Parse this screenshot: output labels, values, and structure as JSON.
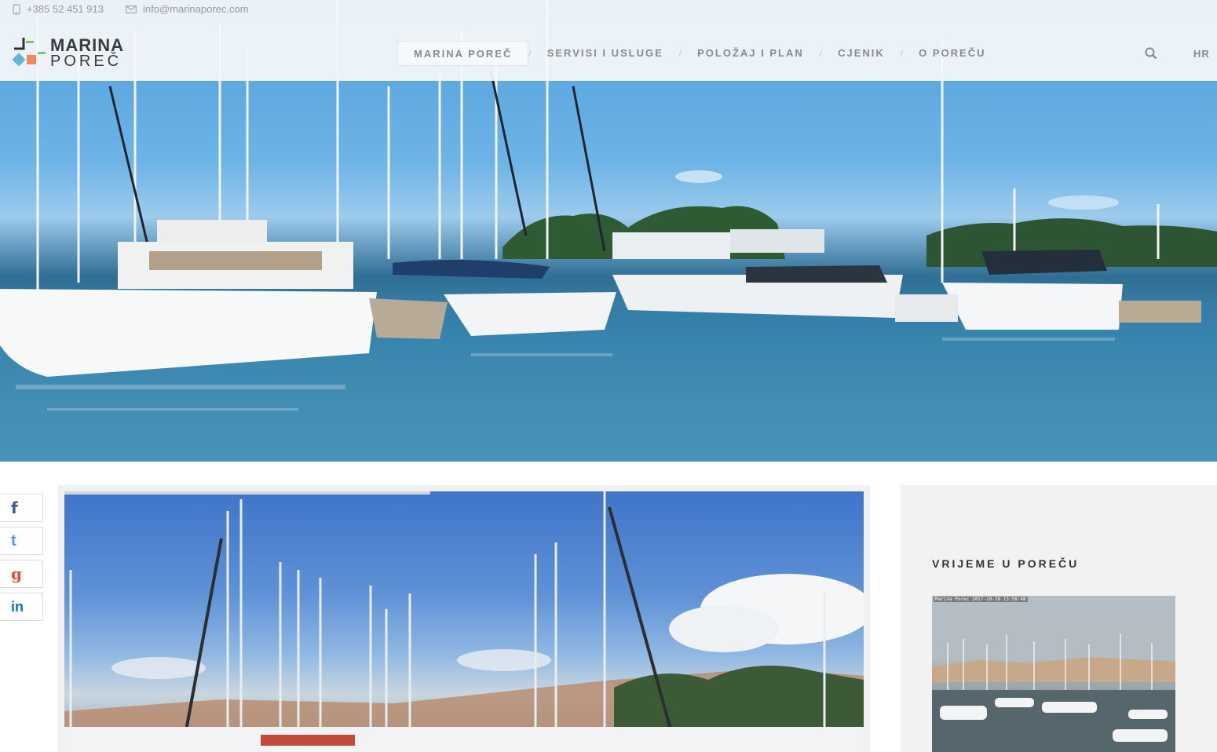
{
  "topbar": {
    "phone": "+385 52 451 913",
    "email": "info@marinaporec.com"
  },
  "logo": {
    "line1": "MARINA",
    "line2": "POREČ"
  },
  "nav": {
    "items": [
      {
        "label": "MARINA POREČ",
        "active": true
      },
      {
        "label": "SERVISI I USLUGE"
      },
      {
        "label": "POLOŽAJ I PLAN"
      },
      {
        "label": "CJENIK"
      },
      {
        "label": "O POREČU"
      }
    ],
    "separator": "/",
    "language": "HR"
  },
  "share": {
    "facebook": "f",
    "twitter": "t",
    "google": "g",
    "linkedin": "in"
  },
  "sidebar": {
    "title": "VRIJEME U POREČU",
    "webcam_stamp": "Marina Porec 2017-10-28 13:58:48"
  },
  "colors": {
    "nav_text": "#8a8a8a",
    "logo_green": "#7cc576",
    "logo_orange": "#f08a5d",
    "logo_blue": "#5bb8d6"
  },
  "icons": [
    "phone-icon",
    "mail-icon",
    "search-icon",
    "facebook-icon",
    "twitter-icon",
    "google-plus-icon",
    "linkedin-icon"
  ]
}
